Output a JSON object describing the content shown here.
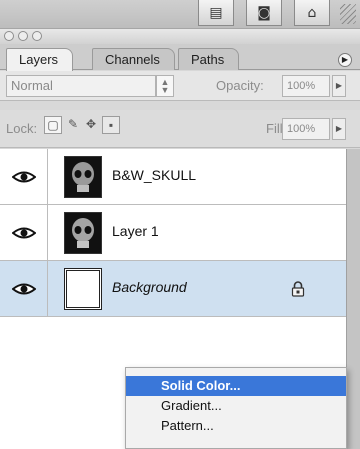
{
  "toolbar": {
    "buttons": [
      {
        "name": "new-group-button",
        "glyph": "▤"
      },
      {
        "name": "new-layer-button",
        "glyph": "◙"
      },
      {
        "name": "delete-layer-button",
        "glyph": "🗑"
      }
    ]
  },
  "tabs": [
    {
      "label": "Layers"
    },
    {
      "label": "Channels"
    },
    {
      "label": "Paths"
    }
  ],
  "blend": {
    "mode": "Normal",
    "opacity_label": "Opacity:",
    "opacity_value": "100%"
  },
  "lock_row": {
    "lock_label": "Lock:",
    "fill_label": "Fill:",
    "fill_value": "100%"
  },
  "layers": [
    {
      "name": "B&W_SKULL",
      "thumbnail": "skull",
      "visible": true,
      "selected": false,
      "locked": false
    },
    {
      "name": "Layer 1",
      "thumbnail": "skull",
      "visible": true,
      "selected": false,
      "locked": false
    },
    {
      "name": "Background",
      "thumbnail": "white",
      "visible": true,
      "selected": true,
      "locked": true
    }
  ],
  "context_menu": {
    "items": [
      {
        "label": "Solid Color...",
        "highlighted": true
      },
      {
        "label": "Gradient...",
        "highlighted": false
      },
      {
        "label": "Pattern...",
        "highlighted": false
      }
    ]
  },
  "colors": {
    "selection": "#cfe0f0",
    "menu_highlight": "#3a77d9"
  }
}
